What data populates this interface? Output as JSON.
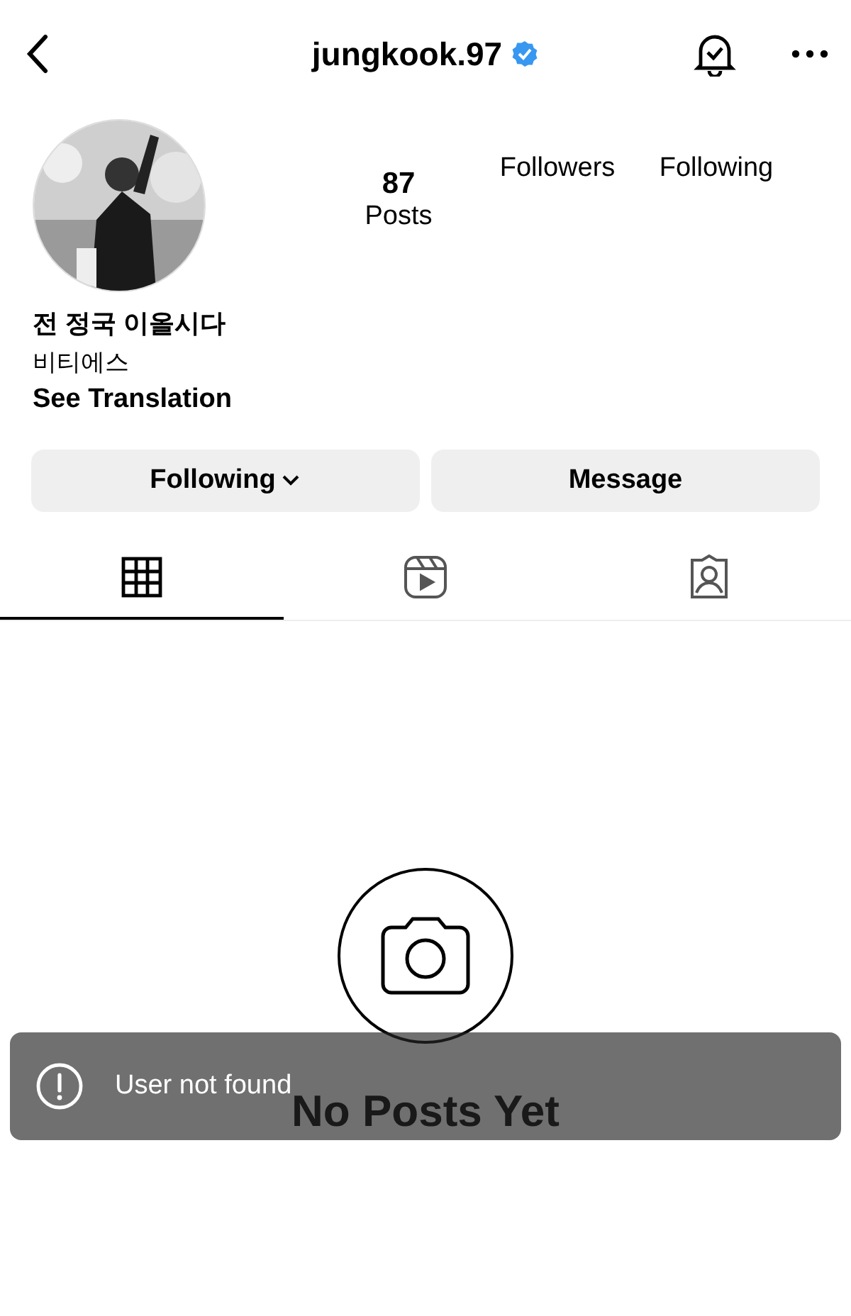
{
  "header": {
    "username": "jungkook.97",
    "verified": true
  },
  "profile": {
    "posts_count": "87",
    "posts_label": "Posts",
    "followers_label": "Followers",
    "following_label": "Following",
    "name": "전 정국 이올시다",
    "bio": "비티에스",
    "translation_link": "See Translation"
  },
  "buttons": [
    {
      "label": "Following",
      "kind": "dropdown"
    },
    {
      "label": "Message",
      "kind": "plain"
    }
  ],
  "tabs": [
    {
      "kind": "grid",
      "selected": true
    },
    {
      "kind": "reels",
      "selected": false
    },
    {
      "kind": "tagged",
      "selected": false
    }
  ],
  "empty_state": {
    "title": "No Posts Yet"
  },
  "toast": {
    "message": "User not found"
  }
}
